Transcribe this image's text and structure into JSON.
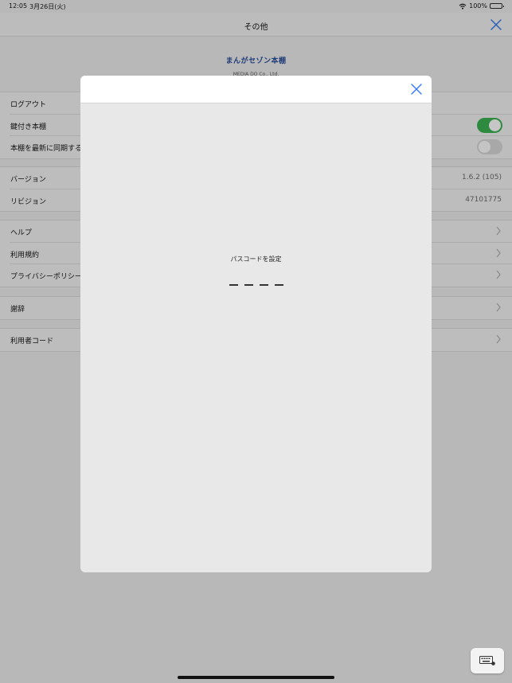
{
  "status_bar": {
    "time": "12:05",
    "date": "3月26日(火)",
    "battery": "100%"
  },
  "nav": {
    "title": "その他"
  },
  "logo": {
    "text": "まんがセゾン本棚",
    "company": "MEDIA DO Co., Ltd."
  },
  "groups": [
    {
      "rows": [
        {
          "label": "ログアウト"
        },
        {
          "label": "鍵付き本棚",
          "toggle": "on"
        },
        {
          "label": "本棚を最新に同期する",
          "toggle": "off"
        }
      ]
    },
    {
      "rows": [
        {
          "label": "バージョン",
          "value": "1.6.2 (105)"
        },
        {
          "label": "リビジョン",
          "value": "47101775"
        }
      ]
    },
    {
      "rows": [
        {
          "label": "ヘルプ"
        },
        {
          "label": "利用規約"
        },
        {
          "label": "プライバシーポリシー"
        }
      ]
    },
    {
      "rows": [
        {
          "label": "謝辞"
        }
      ]
    },
    {
      "rows": [
        {
          "label": "利用者コード"
        }
      ]
    }
  ],
  "modal": {
    "title": "パスコードを設定",
    "passcode_digits": 4
  },
  "colors": {
    "accent": "#3478f6",
    "toggle_on": "#34c759"
  },
  "icons": {
    "wifi": "wifi-icon",
    "battery": "battery-icon",
    "close": "close-icon",
    "chevron": "chevron-right-icon",
    "keyboard": "keyboard-icon"
  }
}
